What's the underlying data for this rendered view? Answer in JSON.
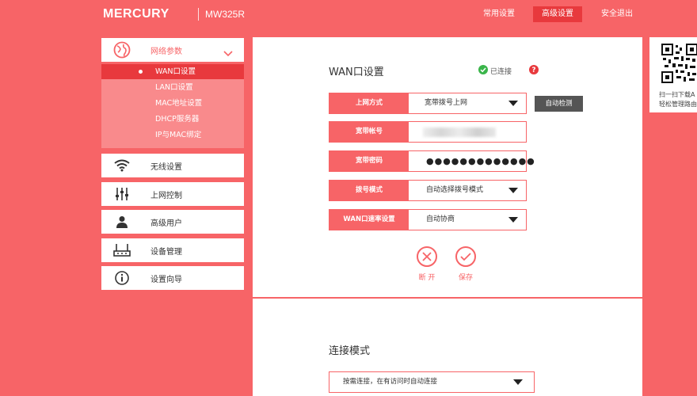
{
  "header": {
    "brand": "MERCURY",
    "model": "MW325R",
    "nav": [
      "常用设置",
      "高级设置",
      "安全退出"
    ],
    "active_nav": "高级设置"
  },
  "sidebar": {
    "network": {
      "label": "网络参数",
      "sub_items": [
        "WAN口设置",
        "LAN口设置",
        "MAC地址设置",
        "DHCP服务器",
        "IP与MAC绑定"
      ],
      "active": "WAN口设置"
    },
    "items": [
      {
        "label": "无线设置",
        "icon": "wifi-icon"
      },
      {
        "label": "上网控制",
        "icon": "sliders-icon"
      },
      {
        "label": "高级用户",
        "icon": "user-icon"
      },
      {
        "label": "设备管理",
        "icon": "router-icon"
      },
      {
        "label": "设置向导",
        "icon": "info-icon"
      }
    ]
  },
  "wan": {
    "title": "WAN口设置",
    "status": "已连接",
    "fields": {
      "internet_mode": {
        "label": "上网方式",
        "value": "宽带拨号上网"
      },
      "account": {
        "label": "宽带帐号",
        "value": ""
      },
      "password": {
        "label": "宽带密码",
        "value": "●●●●●●●●●●●●●"
      },
      "dial_mode": {
        "label": "拨号模式",
        "value": "自动选择拨号模式"
      },
      "speed": {
        "label": "WAN口速率设置",
        "value": "自动协商"
      }
    },
    "detect_button": "自动检测",
    "disconnect_label": "断 开",
    "save_label": "保存"
  },
  "connection": {
    "title": "连接模式",
    "value": "按需连接，在有访问时自动连接"
  },
  "qr": {
    "line1": "扫一扫下载A",
    "line2": "轻松管理路由"
  },
  "colors": {
    "brand": "#f76467",
    "active": "#e8393d",
    "submenu": "#f98a8c",
    "status_ok": "#3ab54a",
    "help": "#e8393d"
  }
}
